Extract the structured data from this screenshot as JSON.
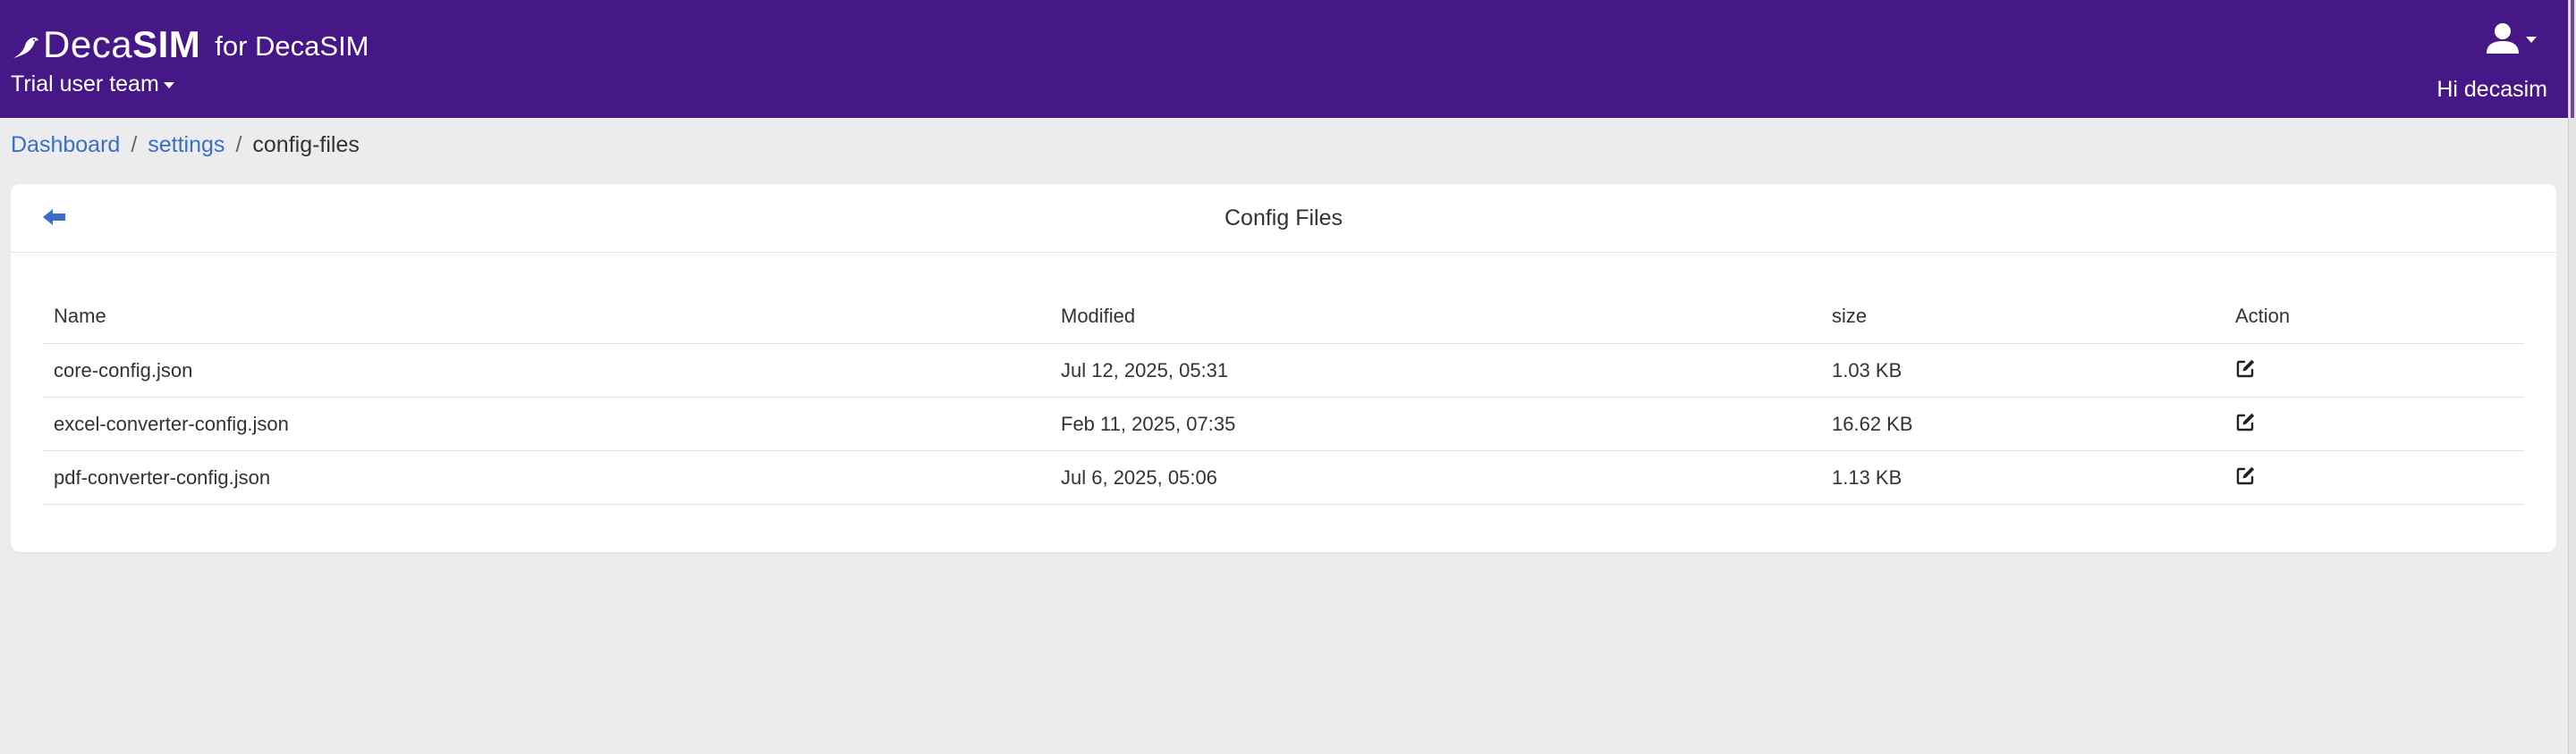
{
  "header": {
    "brand_prefix": "Deca",
    "brand_suffix": "SIM",
    "brand_tagline": "for DecaSIM",
    "team_label": "Trial user team",
    "greeting": "Hi decasim",
    "user_icon": "user-icon",
    "background_color": "#461787"
  },
  "breadcrumb": {
    "items": [
      {
        "label": "Dashboard"
      },
      {
        "label": "settings"
      },
      {
        "label": "config-files"
      }
    ],
    "separator": "/"
  },
  "card": {
    "title": "Config Files",
    "back_icon": "arrow-left-icon"
  },
  "table": {
    "columns": [
      "Name",
      "Modified",
      "size",
      "Action"
    ],
    "rows": [
      {
        "name": "core-config.json",
        "modified": "Jul 12, 2025, 05:31",
        "size": "1.03 KB",
        "action_icon": "edit-icon"
      },
      {
        "name": "excel-converter-config.json",
        "modified": "Feb 11, 2025, 07:35",
        "size": "16.62 KB",
        "action_icon": "edit-icon"
      },
      {
        "name": "pdf-converter-config.json",
        "modified": "Jul 6, 2025, 05:06",
        "size": "1.13 KB",
        "action_icon": "edit-icon"
      }
    ]
  },
  "colors": {
    "link": "#3a6ec8",
    "page_background": "#ececef"
  }
}
